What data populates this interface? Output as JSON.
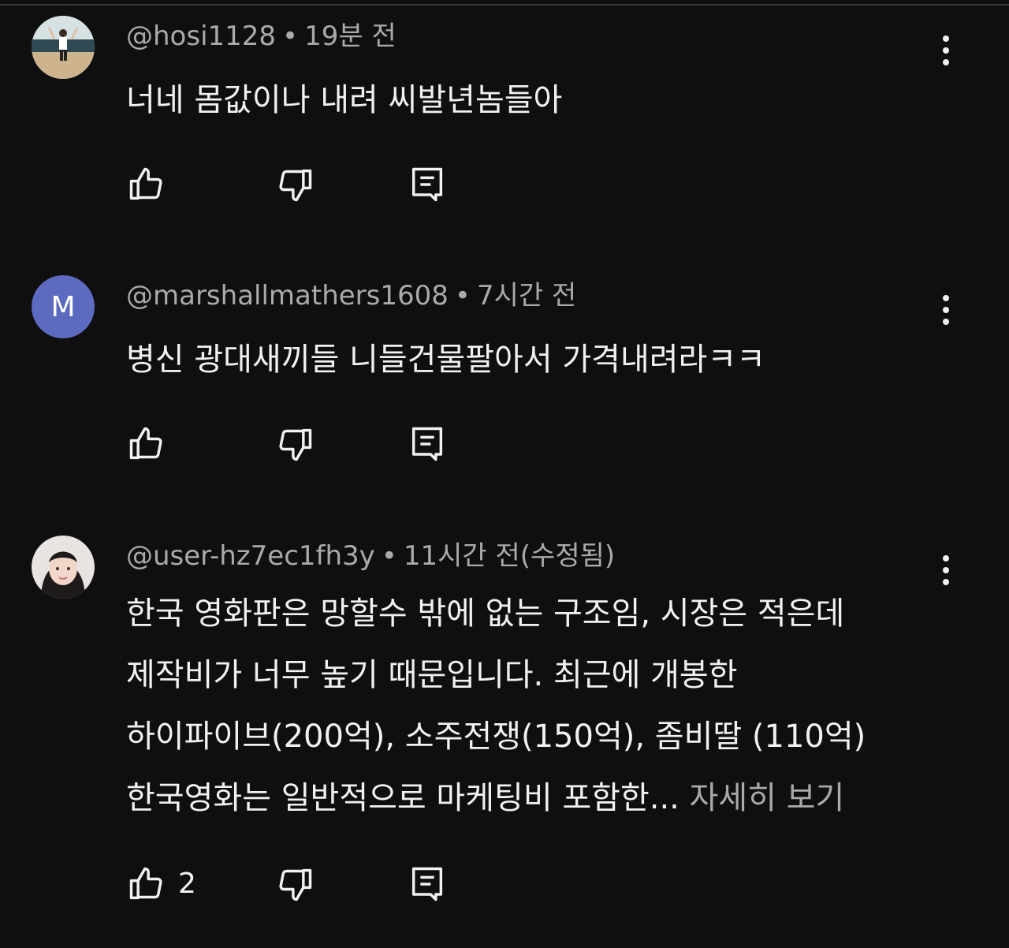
{
  "comments": [
    {
      "handle": "@hosi1128",
      "separator": "•",
      "time": "19분 전",
      "lines": [
        "너네 몸값이나 내려 씨발년놈들아"
      ],
      "likes": ""
    },
    {
      "avatar_letter": "M",
      "handle": "@marshallmathers1608",
      "separator": "•",
      "time": "7시간 전",
      "lines": [
        "병신 광대새끼들  니들건물팔아서 가격내려라ㅋㅋ"
      ],
      "likes": ""
    },
    {
      "handle": "@user-hz7ec1fh3y",
      "separator": "•",
      "time": "11시간 전(수정됨)",
      "lines": [
        "한국 영화판은 망할수 밖에 없는 구조임, 시장은 적은데",
        "제작비가 너무 높기 때문입니다. 최근에 개봉한",
        "하이파이브(200억), 소주전쟁(150억), 좀비딸 (110억)",
        "한국영화는 일반적으로 마케팅비 포함한... "
      ],
      "more_label": "자세히 보기",
      "likes": "2"
    }
  ],
  "icons": {
    "like": "thumbs-up-icon",
    "dislike": "thumbs-down-icon",
    "reply": "reply-icon",
    "menu": "more-vert-icon"
  },
  "colors": {
    "background": "#0f0f0f",
    "text": "#f1f1f1",
    "secondary": "#aaaaaa",
    "avatar_m": "#5c6bc0"
  }
}
